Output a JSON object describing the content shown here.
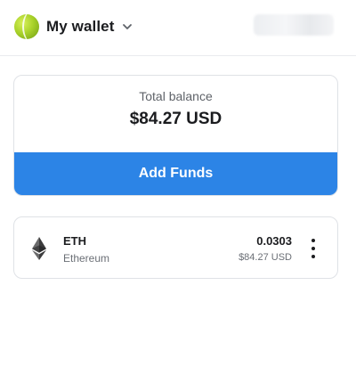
{
  "header": {
    "wallet_name": "My wallet",
    "avatar_icon": "wallet-avatar-icon",
    "chevron_icon": "chevron-down-icon",
    "account_chip": "blurred-account-address"
  },
  "balance": {
    "label": "Total balance",
    "value": "$84.27 USD",
    "add_funds_label": "Add Funds",
    "accent_color": "#2c84e6"
  },
  "assets": [
    {
      "symbol": "ETH",
      "name": "Ethereum",
      "amount": "0.0303",
      "fiat": "$84.27 USD",
      "icon": "ethereum-icon",
      "menu_icon": "more-vertical-icon"
    }
  ]
}
